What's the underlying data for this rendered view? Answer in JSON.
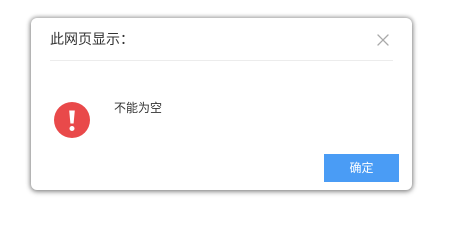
{
  "dialog": {
    "title": "此网页显示：",
    "close_icon": "close-icon",
    "alert_icon": "exclamation-circle-icon",
    "message": "不能为空",
    "ok_label": "确定"
  },
  "colors": {
    "alert": "#e9494a",
    "button": "#4a9cf5",
    "close": "#a9a9a9",
    "divider": "#ececec",
    "text": "#333333"
  }
}
